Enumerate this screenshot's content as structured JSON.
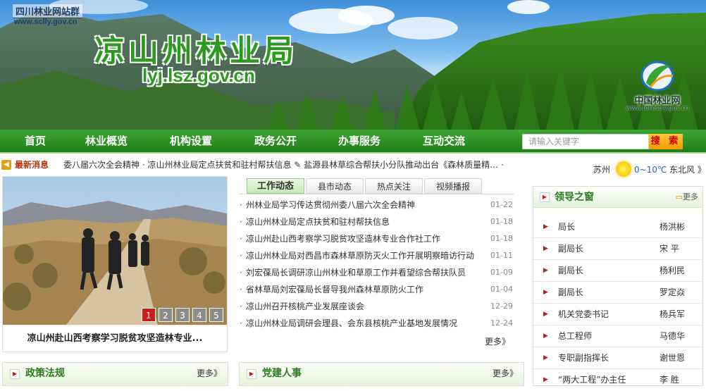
{
  "banner": {
    "site_group": "四川林业网站群",
    "site_url": "www.sclly.gov.cn",
    "title": "凉山州林业局",
    "domain": "lyj.lsz.gov.cn",
    "partner_name": "中国林业网",
    "partner_url": "www.forestry.gov.cn"
  },
  "nav": {
    "items": [
      "首页",
      "林业概览",
      "机构设置",
      "政务公开",
      "办事服务",
      "互动交流"
    ],
    "search_placeholder": "请输入关键字",
    "search_button": "搜 索"
  },
  "ticker": {
    "label": "最新消息",
    "text": "委八届六次全会精神 · 凉山州林业局定点扶贫和驻村帮扶信息 ✎ 盐源县林草综合帮扶小分队推动出台《森林质量精… ·"
  },
  "weather": {
    "city": "苏州",
    "temp": "0~10℃",
    "wind": "东北风 》"
  },
  "slideshow": {
    "caption": "凉山州赴山西考察学习脱贫攻坚造林专业...",
    "pages": [
      "1",
      "2",
      "3",
      "4",
      "5"
    ],
    "active_page": 1
  },
  "news": {
    "tabs": [
      "工作动态",
      "县市动态",
      "热点关注",
      "视频播报"
    ],
    "active_tab": 0,
    "items": [
      {
        "title": "州林业局学习传达贯彻州委八届六次全会精神",
        "date": "01-22"
      },
      {
        "title": "凉山州林业局定点扶贫和驻村帮扶信息",
        "date": "01-18"
      },
      {
        "title": "凉山州赴山西考察学习脱贫攻坚造林专业合作社工作",
        "date": "01-18"
      },
      {
        "title": "凉山州林业局对西昌市森林草原防灭火工作开展明察暗访行动",
        "date": "01-11"
      },
      {
        "title": "刘宏葆局长调研凉山州林业和草原工作并看望综合帮扶队员",
        "date": "01-09"
      },
      {
        "title": "省林草局刘宏葆局长督导我州森林草原防火工作",
        "date": "01-04"
      },
      {
        "title": "凉山州召开核桃产业发展座谈会",
        "date": "12-29"
      },
      {
        "title": "凉山州林业局调研会理县、会东县核桃产业基地发展情况",
        "date": "12-24"
      }
    ],
    "more": "更多》"
  },
  "leaders": {
    "title": "领导之窗",
    "more": "更多",
    "items": [
      {
        "position": "局长",
        "name": "杨洪彬"
      },
      {
        "position": "副局长",
        "name": "宋 平"
      },
      {
        "position": "副局长",
        "name": "杨利民"
      },
      {
        "position": "副局长",
        "name": "罗定焱"
      },
      {
        "position": "机关党委书记",
        "name": "杨兵军"
      },
      {
        "position": "总工程师",
        "name": "马德华"
      },
      {
        "position": "专职副指挥长",
        "name": "谢世恩"
      },
      {
        "position": "“两大工程”办主任",
        "name": "李 胜"
      }
    ]
  },
  "policy": {
    "title": "政策法规",
    "more": "更多》"
  },
  "party": {
    "title": "党建人事",
    "more": "更多》"
  }
}
